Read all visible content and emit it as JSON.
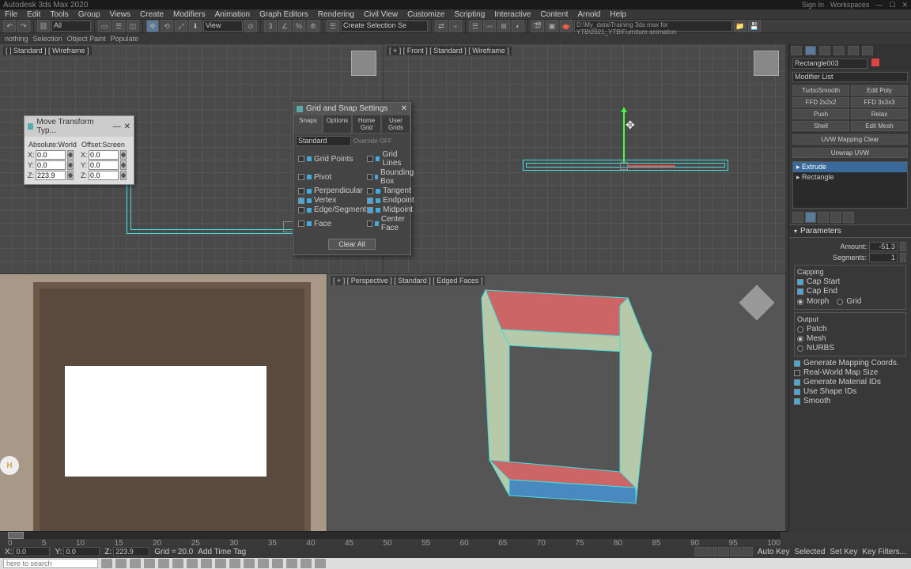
{
  "title": "Autodesk 3ds Max 2020",
  "signin": "Sign In",
  "workspaces_label": "Workspaces",
  "menu": [
    "File",
    "Edit",
    "Tools",
    "Group",
    "Views",
    "Create",
    "Modifiers",
    "Animation",
    "Graph Editors",
    "Rendering",
    "Civil View",
    "Customize",
    "Scripting",
    "Interactive",
    "Content",
    "Arnold",
    "Help"
  ],
  "toolbar": {
    "all": "All",
    "create_sel": "Create Selection Se",
    "path": "D:\\My_data\\Training 3ds max for YTB\\2021_YTB\\Furniture animation"
  },
  "row2": [
    "nothing",
    "Selection",
    "Object Paint",
    "Populate"
  ],
  "viewports": {
    "tl": "[ ] Standard ] [ Wireframe ]",
    "tr": "[ + ] [ Front ] [ Standard ] [ Wireframe ]",
    "br": "[ + ] [ Perspective ] [ Standard ] [ Edged Faces ]"
  },
  "transform": {
    "title": "Move Transform Typ...",
    "col1": "Absolute:World",
    "col2": "Offset:Screen",
    "rows": [
      {
        "l": "X:",
        "v1": "0.0",
        "v2": "0.0"
      },
      {
        "l": "Y:",
        "v1": "0.0",
        "v2": "0.0"
      },
      {
        "l": "Z:",
        "v1": "223.9",
        "v2": "0.0"
      }
    ]
  },
  "snap": {
    "title": "Grid and Snap Settings",
    "tabs": [
      "Snaps",
      "Options",
      "Home Grid",
      "User Grids"
    ],
    "dropdown": "Standard",
    "override": "Override OFF",
    "left": [
      {
        "t": "Grid Points",
        "on": false
      },
      {
        "t": "Pivot",
        "on": false
      },
      {
        "t": "Perpendicular",
        "on": false
      },
      {
        "t": "Vertex",
        "on": true
      },
      {
        "t": "Edge/Segment",
        "on": false
      },
      {
        "t": "Face",
        "on": false
      }
    ],
    "right": [
      {
        "t": "Grid Lines",
        "on": false
      },
      {
        "t": "Bounding Box",
        "on": false
      },
      {
        "t": "Tangent",
        "on": false
      },
      {
        "t": "Endpoint",
        "on": true
      },
      {
        "t": "Midpoint",
        "on": true
      },
      {
        "t": "Center Face",
        "on": false
      }
    ],
    "clear": "Clear All"
  },
  "side": {
    "objname": "Rectangle003",
    "modlist": "Modifier List",
    "btns": [
      "TurboSmooth",
      "Edit Poly",
      "FFD 2x2x2",
      "FFD 3x3x3",
      "Push",
      "Relax",
      "Shell",
      "Edit Mesh"
    ],
    "btn_wide": "UVW Mapping Clear",
    "btn_unwrap": "Unwrap UVW",
    "stack": [
      {
        "t": "Extrude",
        "sel": true
      },
      {
        "t": "Rectangle",
        "sel": false
      }
    ],
    "roll": "Parameters",
    "params": {
      "amount_l": "Amount:",
      "amount_v": "-51.3",
      "seg_l": "Segments:",
      "seg_v": "1",
      "capping": "Capping",
      "capstart": "Cap Start",
      "capend": "Cap End",
      "morph": "Morph",
      "grid": "Grid",
      "output": "Output",
      "patch": "Patch",
      "mesh": "Mesh",
      "nurbs": "NURBS",
      "genmap": "Generate Mapping Coords.",
      "realworld": "Real-World Map Size",
      "genmat": "Generate Material IDs",
      "useshape": "Use Shape IDs",
      "smooth": "Smooth"
    }
  },
  "timeline_ticks": [
    "0",
    "5",
    "10",
    "15",
    "20",
    "25",
    "30",
    "35",
    "40",
    "45",
    "50",
    "55",
    "60",
    "65",
    "70",
    "75",
    "80",
    "85",
    "90",
    "95",
    "100"
  ],
  "status": {
    "x": "X:",
    "y": "Y:",
    "z": "Z:",
    "xv": "0.0",
    "yv": "0.0",
    "zv": "223.9",
    "grid": "Grid =",
    "gridv": "20.0",
    "addtime": "Add Time Tag",
    "autokey": "Auto Key",
    "selected": "Selected",
    "setkey": "Set Key",
    "keyfilters": "Key Filters..."
  },
  "taskbar": {
    "search": "here to search"
  }
}
